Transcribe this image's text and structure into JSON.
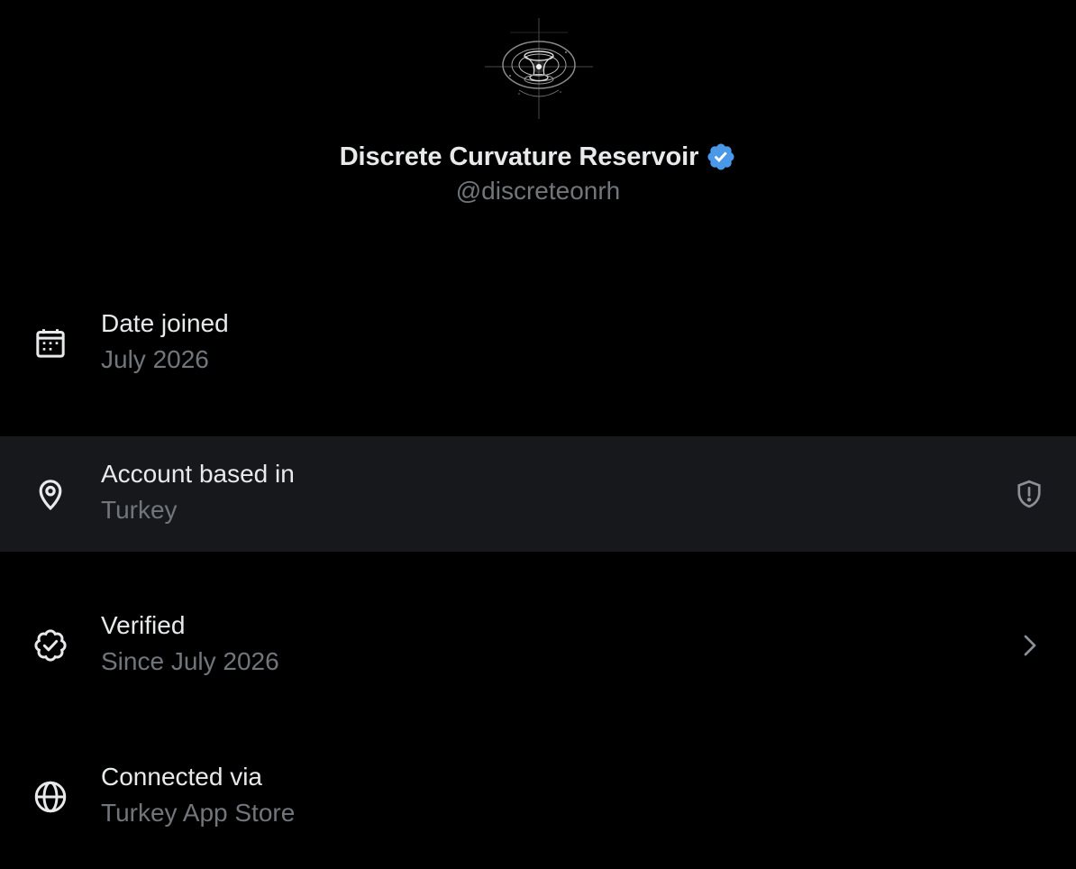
{
  "profile": {
    "display_name": "Discrete Curvature Reservoir",
    "handle": "@discreteonrh",
    "avatar_icon": "abstract-wormhole-avatar",
    "verified_icon": "verified-badge-icon",
    "verified_color": "#4a99e9"
  },
  "rows": [
    {
      "icon": "calendar-icon",
      "title": "Date joined",
      "subtitle": "July 2026"
    },
    {
      "icon": "location-pin-icon",
      "title": "Account based in",
      "subtitle": "Turkey",
      "trailing_icon": "shield-alert-icon",
      "highlighted": true
    },
    {
      "icon": "verified-check-icon",
      "title": "Verified",
      "subtitle": "Since July 2026",
      "trailing_icon": "chevron-right-icon"
    },
    {
      "icon": "globe-icon",
      "title": "Connected via",
      "subtitle": "Turkey App Store"
    }
  ],
  "colors": {
    "background": "#000000",
    "highlight_row": "#16181c",
    "primary_text": "#e7e9ea",
    "secondary_text": "#71767b"
  }
}
